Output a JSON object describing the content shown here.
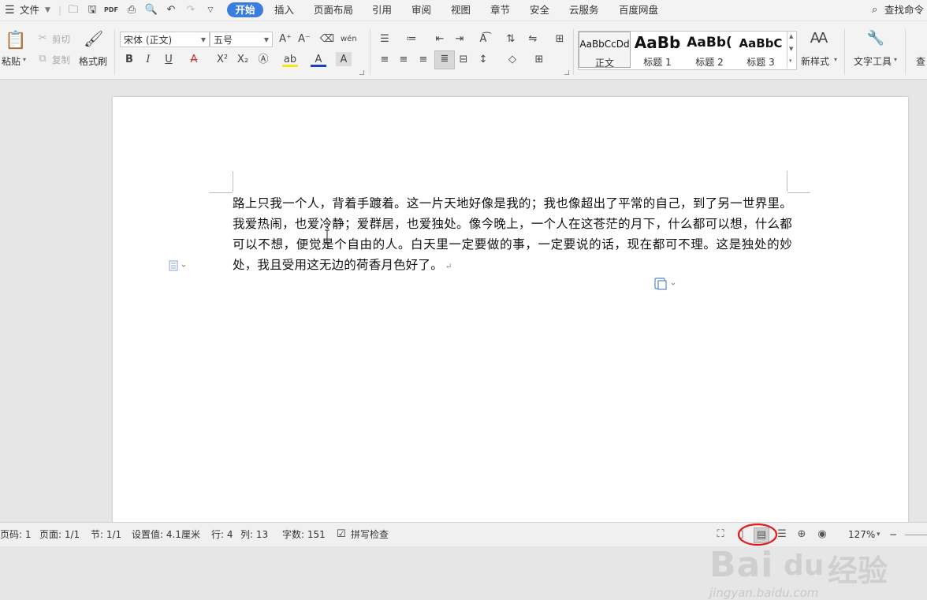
{
  "menubar": {
    "file_menu": "文件",
    "tabs": [
      "开始",
      "插入",
      "页面布局",
      "引用",
      "审阅",
      "视图",
      "章节",
      "安全",
      "云服务",
      "百度网盘"
    ],
    "search_label": "查找命令"
  },
  "ribbon": {
    "paste": "粘贴",
    "cut": "剪切",
    "copy": "复制",
    "format_painter": "格式刷",
    "font_name": "宋体 (正文)",
    "font_size": "五号",
    "styles": [
      {
        "sample": "AaBbCcDd",
        "name": "正文"
      },
      {
        "sample": "AaBb",
        "name": "标题 1"
      },
      {
        "sample": "AaBb(",
        "name": "标题 2"
      },
      {
        "sample": "AaBbC",
        "name": "标题 3"
      }
    ],
    "new_style": "新样式",
    "text_tools": "文字工具",
    "find_cut": "查"
  },
  "document": {
    "paragraph": "路上只我一个人，背着手踱着。这一片天地好像是我的；我也像超出了平常的自己，到了另一世界里。我爱热闹，也爱冷静；爱群居，也爱独处。像今晚上，一个人在这苍茫的月下，什么都可以想，什么都可以不想，便觉是个自由的人。白天里一定要做的事，一定要说的话，现在都可不理。这是独处的妙处，我且受用这无边的荷香月色好了。",
    "paragraph_mark": "↵"
  },
  "watermark": {
    "brand": "Bai",
    "brand2": "du",
    "cn": "经验",
    "url": "jingyan.baidu.com"
  },
  "statusbar": {
    "page_code": "页码: 1",
    "pages": "页面: 1/1",
    "section": "节: 1/1",
    "setting": "设置值: 4.1厘米",
    "row": "行: 4",
    "col": "列: 13",
    "word_count": "字数: 151",
    "spell_check": "拼写检查",
    "zoom": "127%"
  }
}
